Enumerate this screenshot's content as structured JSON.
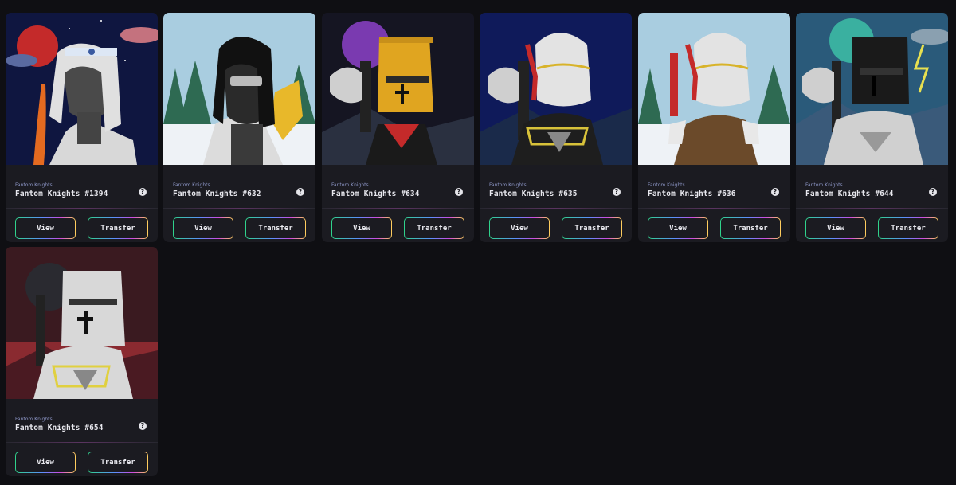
{
  "cards": [
    {
      "collection": "Fantom Knights",
      "name": "Fantom Knights #1394",
      "view_label": "View",
      "transfer_label": "Transfer",
      "help_glyph": "?"
    },
    {
      "collection": "Fantom Knights",
      "name": "Fantom Knights #632",
      "view_label": "View",
      "transfer_label": "Transfer",
      "help_glyph": "?"
    },
    {
      "collection": "Fantom Knights",
      "name": "Fantom Knights #634",
      "view_label": "View",
      "transfer_label": "Transfer",
      "help_glyph": "?"
    },
    {
      "collection": "Fantom Knights",
      "name": "Fantom Knights #635",
      "view_label": "View",
      "transfer_label": "Transfer",
      "help_glyph": "?"
    },
    {
      "collection": "Fantom Knights",
      "name": "Fantom Knights #636",
      "view_label": "View",
      "transfer_label": "Transfer",
      "help_glyph": "?"
    },
    {
      "collection": "Fantom Knights",
      "name": "Fantom Knights #644",
      "view_label": "View",
      "transfer_label": "Transfer",
      "help_glyph": "?"
    },
    {
      "collection": "Fantom Knights",
      "name": "Fantom Knights #654",
      "view_label": "View",
      "transfer_label": "Transfer",
      "help_glyph": "?"
    }
  ],
  "colors": {
    "page_bg": "#0f0f13",
    "card_bg": "#1b1b21",
    "collection_text": "#8b94c4",
    "button_gradient": [
      "#2fd38a",
      "#5b8fff",
      "#d04ae0",
      "#ffd05a"
    ]
  }
}
